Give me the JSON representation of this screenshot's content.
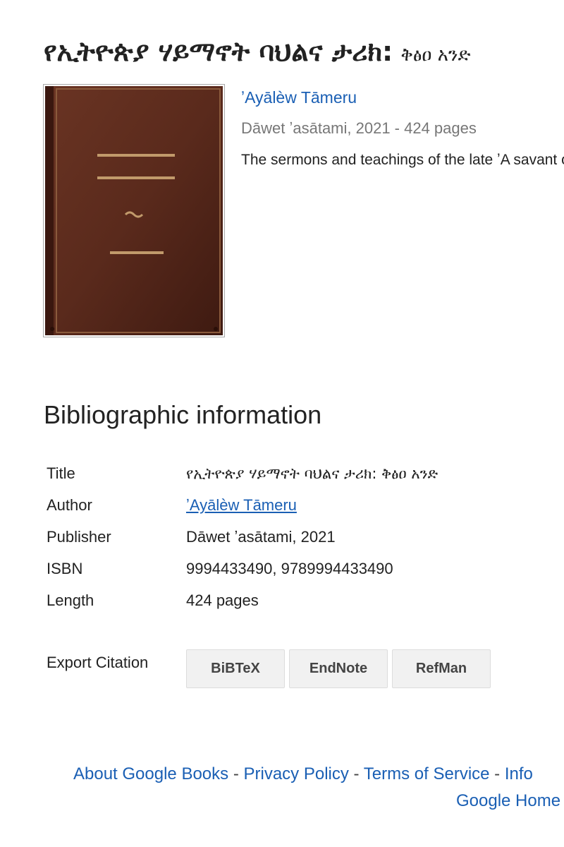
{
  "book": {
    "title_main": "የኢትዮጵያ ሃይማኖት ባህልና ታሪክ:",
    "title_sub": "ቅፅዐ አንድ",
    "author": "ʼAyālèw Tāmeru",
    "publisher_line": "Dāwet ʼasātami, 2021 - 424 pages",
    "description": "The sermons and teachings of the late ʼA savant of the Ethiopian Orthodox Church"
  },
  "bibliographic": {
    "heading": "Bibliographic information",
    "rows": [
      {
        "label": "Title",
        "value": "የኢትዮጵያ ሃይማኖት ባህልና ታሪክ: ቅፅዐ አንድ"
      },
      {
        "label": "Author",
        "value": "ʼAyālèw Tāmeru"
      },
      {
        "label": "Publisher",
        "value": "Dāwet ʼasātami, 2021"
      },
      {
        "label": "ISBN",
        "value": "9994433490, 9789994433490"
      },
      {
        "label": "Length",
        "value": "424 pages"
      }
    ]
  },
  "export": {
    "label": "Export Citation",
    "buttons": [
      "BiBTeX",
      "EndNote",
      "RefMan"
    ]
  },
  "footer": {
    "links": [
      "About Google Books",
      "Privacy Policy",
      "Terms of Service",
      "Info",
      "Google Home"
    ],
    "separator": "-"
  },
  "colors": {
    "link": "#1a5fb4",
    "cover": "#5a2a1c",
    "cover_line": "#c19a6b"
  },
  "icons": {
    "cover": "book-cover-placeholder"
  }
}
